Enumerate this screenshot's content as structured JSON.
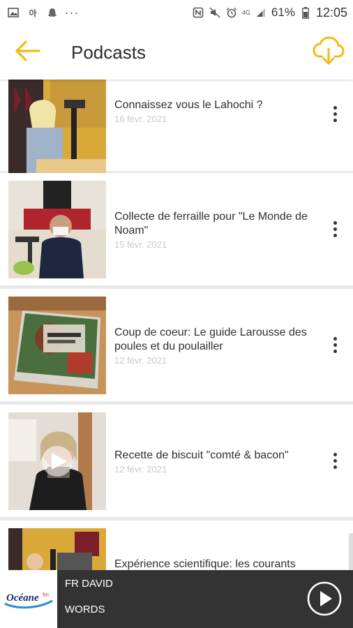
{
  "status_bar": {
    "battery": "61%",
    "time": "12:05",
    "network": "4G"
  },
  "header": {
    "title": "Podcasts"
  },
  "podcasts": [
    {
      "title": "Connaissez vous le Lahochi ?",
      "date": "16 févr. 2021",
      "thumb": "studio-woman"
    },
    {
      "title": "Collecte de ferraille pour \"Le Monde de Noam\"",
      "date": "15 févr. 2021",
      "thumb": "studio-man-mask"
    },
    {
      "title": "Coup de coeur: Le guide Larousse des poules et du poulailler",
      "date": "12 févr. 2021",
      "thumb": "book-poules"
    },
    {
      "title": "Recette de biscuit \"comté & bacon\"",
      "date": "12 févr. 2021",
      "thumb": "woman-video"
    },
    {
      "title": "Expérience scientifique: les courants",
      "date": "",
      "thumb": "studio-child"
    }
  ],
  "player": {
    "artist": "FR DAVID",
    "track": "WORDS",
    "station_logo_text": "Océane fm"
  },
  "colors": {
    "accent": "#f5b913",
    "player_bg": "#333333",
    "background": "#e8e8e8"
  }
}
